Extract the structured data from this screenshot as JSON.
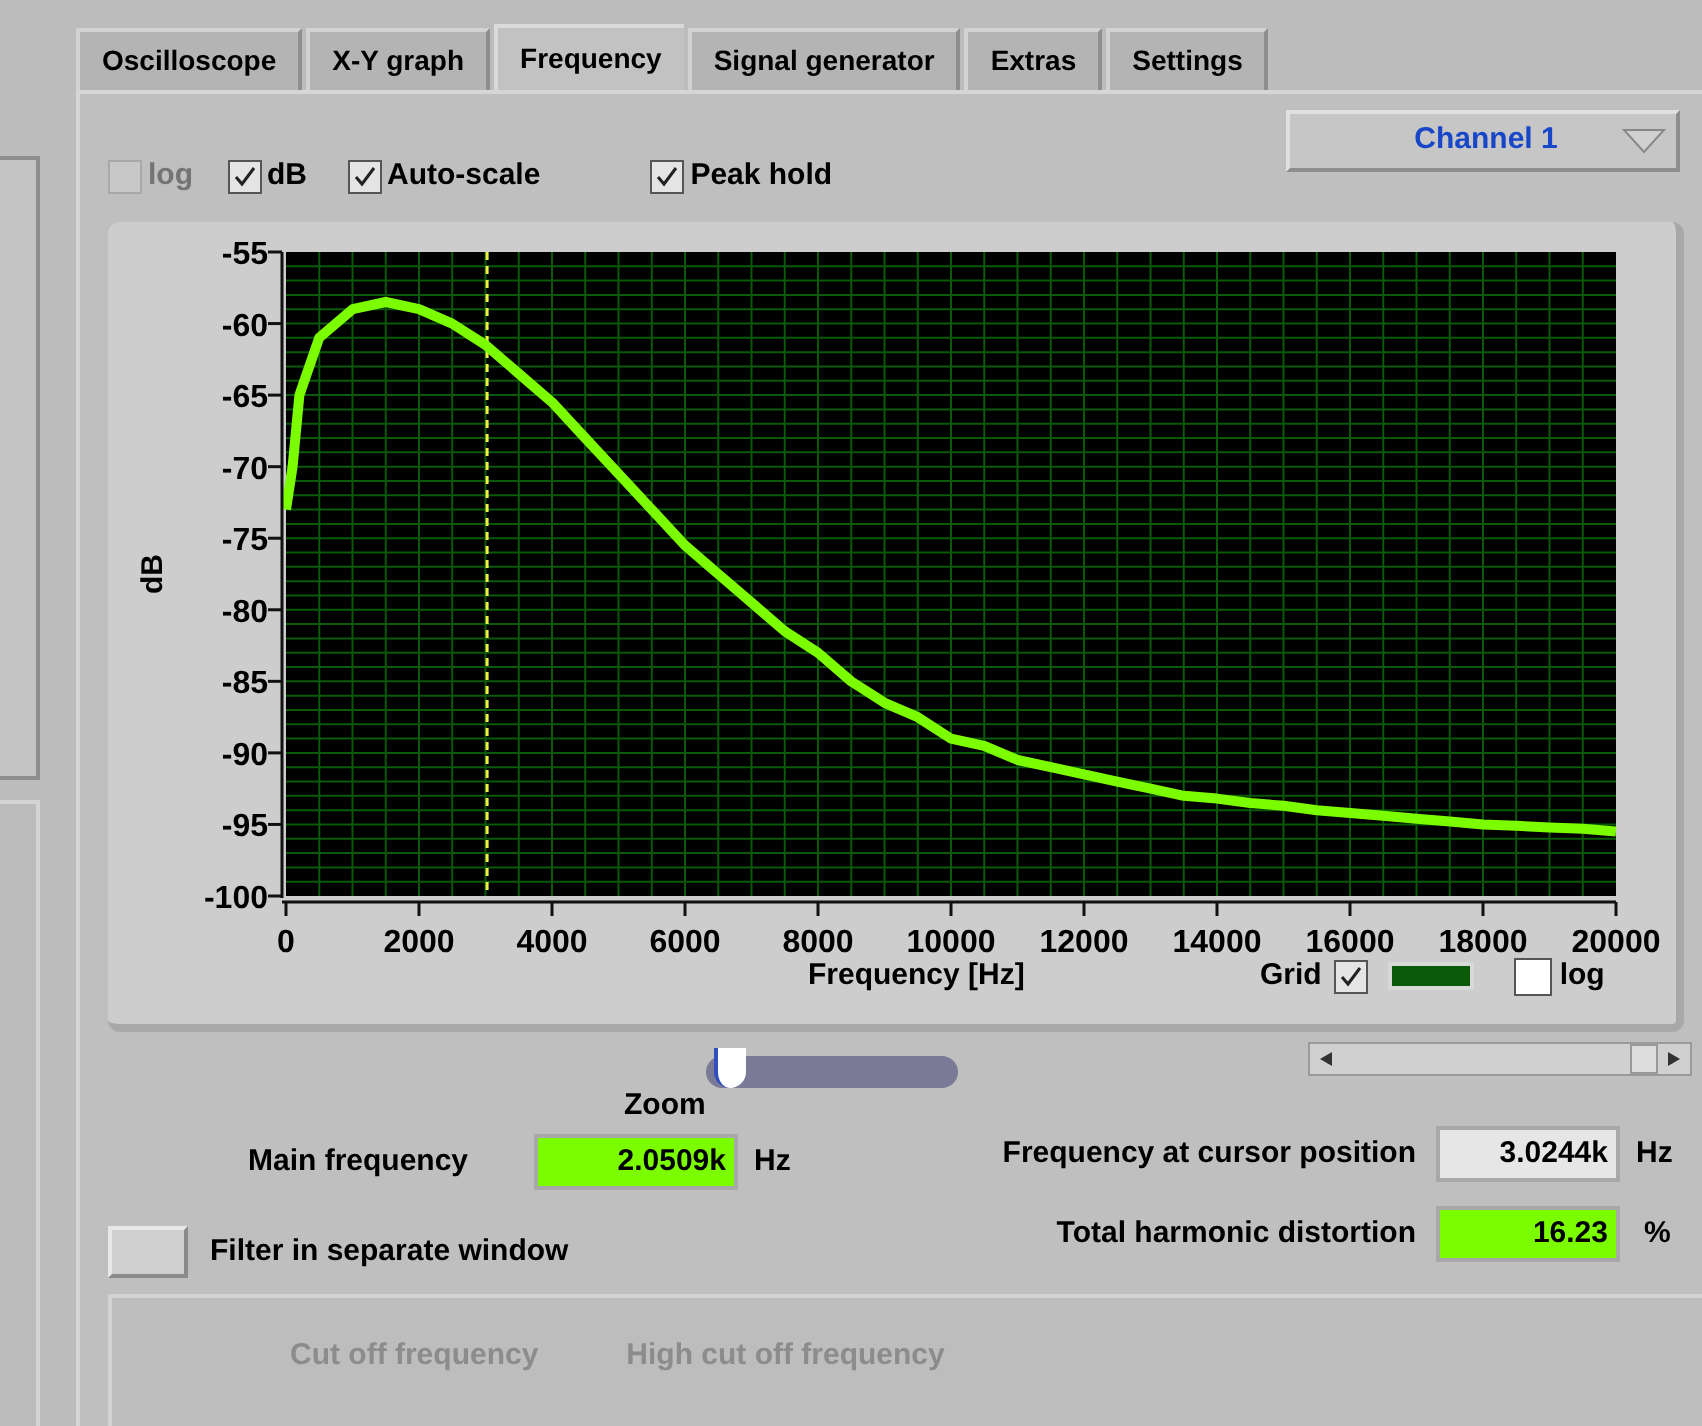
{
  "tabs": [
    {
      "label": "Oscilloscope",
      "selected": false
    },
    {
      "label": "X-Y graph",
      "selected": false
    },
    {
      "label": "Frequency",
      "selected": true
    },
    {
      "label": "Signal generator",
      "selected": false
    },
    {
      "label": "Extras",
      "selected": false
    },
    {
      "label": "Settings",
      "selected": false
    }
  ],
  "options": [
    {
      "label": "log",
      "checked": false,
      "disabled": true
    },
    {
      "label": "dB",
      "checked": true,
      "disabled": false
    },
    {
      "label": "Auto-scale",
      "checked": true,
      "disabled": false
    },
    {
      "label": "Peak hold",
      "checked": true,
      "disabled": false
    }
  ],
  "channel": {
    "value": "Channel 1"
  },
  "spectrum": {
    "chart_data": {
      "type": "line",
      "xlabel": "Frequency [Hz]",
      "ylabel": "dB",
      "x": [
        0,
        100,
        200,
        500,
        1000,
        1500,
        2000,
        2500,
        3000,
        3500,
        4000,
        4500,
        5000,
        5500,
        6000,
        6500,
        7000,
        7500,
        8000,
        8500,
        9000,
        9500,
        10000,
        10500,
        11000,
        11500,
        12000,
        12500,
        13000,
        13500,
        14000,
        14500,
        15000,
        15500,
        16000,
        16500,
        17000,
        17500,
        18000,
        18500,
        19000,
        19500,
        20000
      ],
      "series": [
        {
          "color": "#7cfc00",
          "values": [
            -73,
            -70,
            -65,
            -61,
            -59,
            -58.5,
            -59,
            -60,
            -61.5,
            -63.5,
            -65.5,
            -68,
            -70.5,
            -73,
            -75.5,
            -77.5,
            -79.5,
            -81.5,
            -83,
            -85,
            -86.5,
            -87.5,
            -89,
            -89.5,
            -90.5,
            -91,
            -91.5,
            -92,
            -92.5,
            -93,
            -93.2,
            -93.5,
            -93.7,
            -94,
            -94.2,
            -94.4,
            -94.6,
            -94.8,
            -95,
            -95.1,
            -95.2,
            -95.3,
            -95.5
          ]
        }
      ],
      "xlim": [
        0,
        20000
      ],
      "ylim": [
        -100,
        -55
      ],
      "xticks": [
        0,
        2000,
        4000,
        6000,
        8000,
        10000,
        12000,
        14000,
        16000,
        18000,
        20000
      ],
      "yticks": [
        -55,
        -60,
        -65,
        -70,
        -75,
        -80,
        -85,
        -90,
        -95,
        -100
      ],
      "grid": true,
      "ref_lines": [
        {
          "axis": "x",
          "value": 3024
        }
      ]
    },
    "grid": {
      "label": "Grid",
      "checked": true,
      "color": "#0a5a0a"
    },
    "log_x": {
      "label": "log",
      "checked": false
    }
  },
  "zoom": {
    "label": "Zoom",
    "level": 0.02
  },
  "main_frequency": {
    "label": "Main frequency",
    "value": "2.0509k",
    "unit": "Hz"
  },
  "cursor_frequency": {
    "label": "Frequency at cursor position",
    "value": "3.0244k",
    "unit": "Hz"
  },
  "thd": {
    "label": "Total harmonic distortion",
    "value": "16.23",
    "unit": "%"
  },
  "filter_button": {
    "label": "Filter in separate window"
  },
  "filter_panel": {
    "labels": [
      "Cut off frequency",
      "High cut off frequency"
    ]
  }
}
